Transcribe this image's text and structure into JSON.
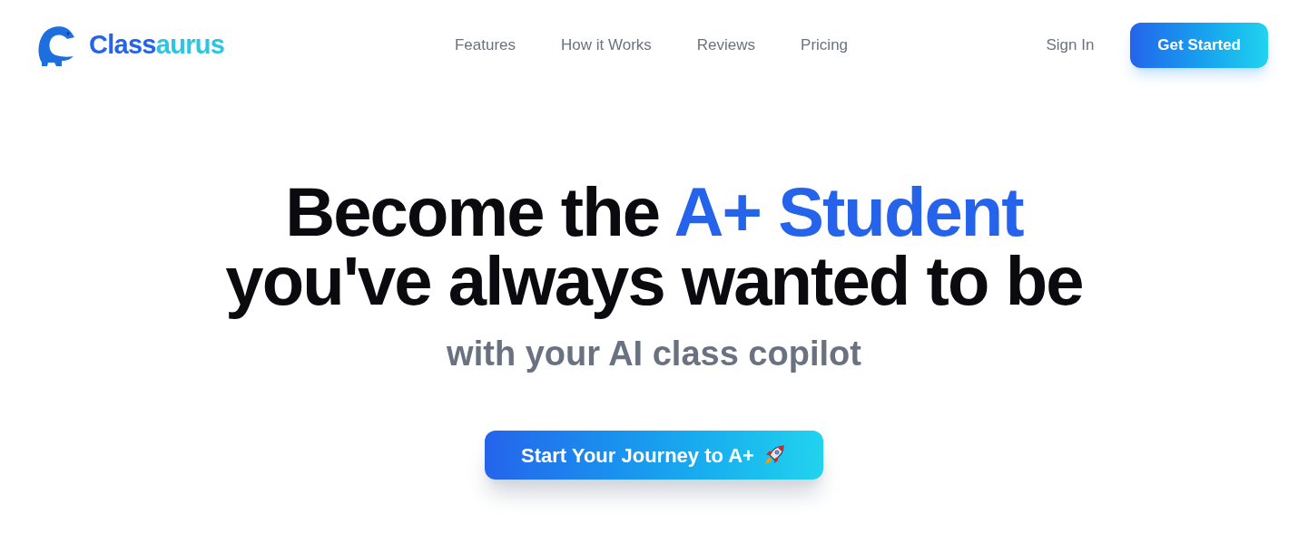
{
  "brand": {
    "parts": [
      {
        "text": "Class",
        "accent": false
      },
      {
        "text": "aurus",
        "accent": true
      }
    ]
  },
  "nav": {
    "links": [
      "Features",
      "How it Works",
      "Reviews",
      "Pricing"
    ],
    "sign_in": "Sign In",
    "cta": "Get Started"
  },
  "hero": {
    "headline": [
      [
        {
          "text": "Become the ",
          "highlight": false
        },
        {
          "text": "A+ Student",
          "highlight": true
        }
      ],
      [
        {
          "text": "you've always wanted to be",
          "highlight": false
        }
      ]
    ],
    "subtitle": "with your AI class copilot",
    "button": "Start Your Journey to A+"
  }
}
